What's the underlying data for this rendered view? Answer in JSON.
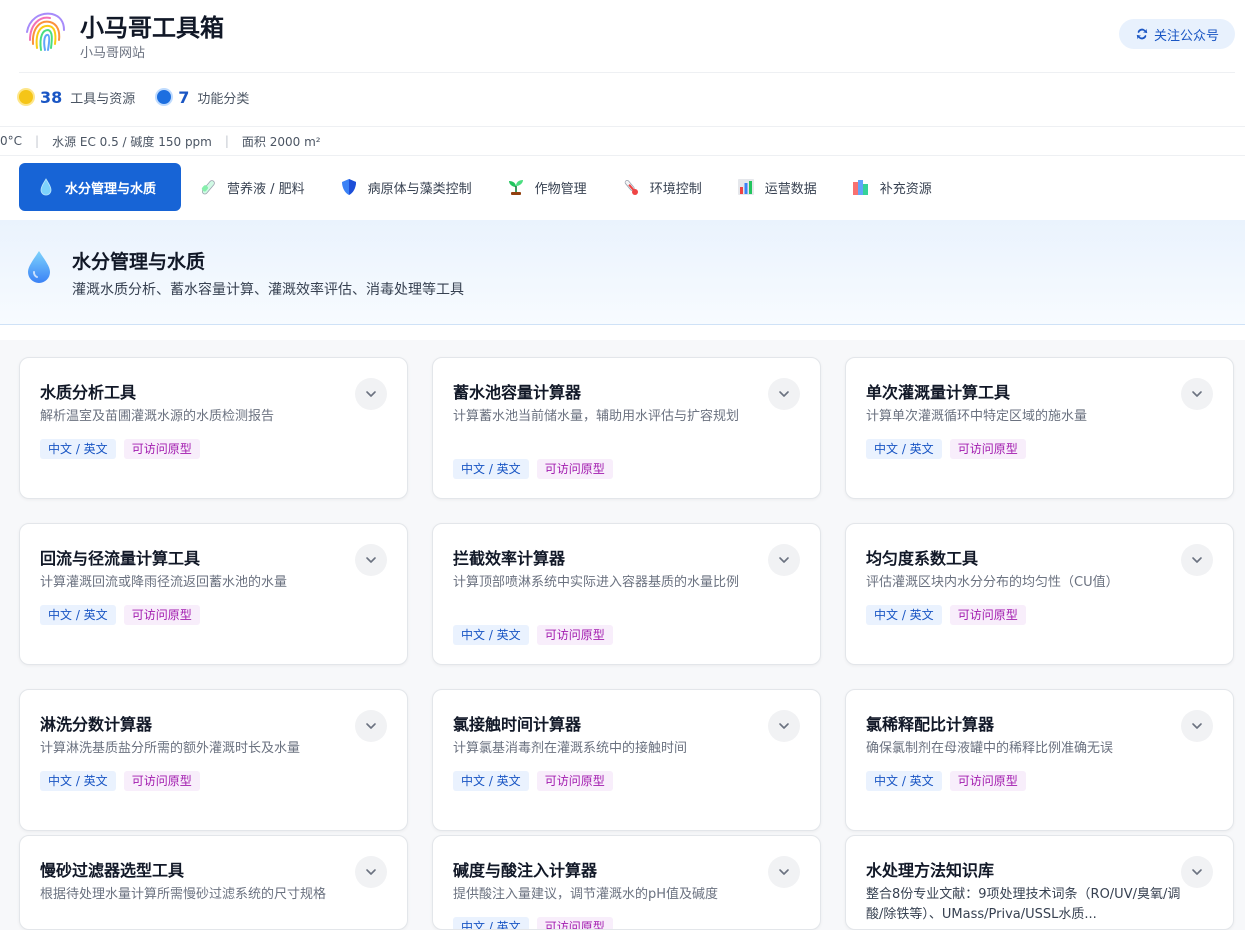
{
  "header": {
    "title": "小马哥工具箱",
    "subtitle": "小马哥网站",
    "follow_label": "关注公众号"
  },
  "stats": [
    {
      "value": "38",
      "label": "工具与资源",
      "color": "#f5c518"
    },
    {
      "value": "7",
      "label": "功能分类",
      "color": "#1d6fe0"
    }
  ],
  "ticker": [
    "0°C",
    "水源 EC 0.5 / 碱度 150 ppm",
    "面积 2000 m²"
  ],
  "tabs": [
    {
      "label": "水分管理与水质",
      "icon": "water-drop-icon",
      "active": true
    },
    {
      "label": "营养液 / 肥料",
      "icon": "test-tube-icon",
      "active": false
    },
    {
      "label": "病原体与藻类控制",
      "icon": "shield-icon",
      "active": false
    },
    {
      "label": "作物管理",
      "icon": "seedling-icon",
      "active": false
    },
    {
      "label": "环境控制",
      "icon": "thermometer-icon",
      "active": false
    },
    {
      "label": "运营数据",
      "icon": "bar-chart-icon",
      "active": false
    },
    {
      "label": "补充资源",
      "icon": "books-icon",
      "active": false
    }
  ],
  "section": {
    "title": "水分管理与水质",
    "description": "灌溉水质分析、蓄水容量计算、灌溉效率评估、消毒处理等工具"
  },
  "tag_labels": {
    "lang": "中文 / 英文",
    "proto": "可访问原型"
  },
  "cards": [
    {
      "title": "水质分析工具",
      "desc": "解析温室及苗圃灌溉水源的水质检测报告"
    },
    {
      "title": "蓄水池容量计算器",
      "desc": "计算蓄水池当前储水量，辅助用水评估与扩容规划"
    },
    {
      "title": "单次灌溉量计算工具",
      "desc": "计算单次灌溉循环中特定区域的施水量"
    },
    {
      "title": "回流与径流量计算工具",
      "desc": "计算灌溉回流或降雨径流返回蓄水池的水量"
    },
    {
      "title": "拦截效率计算器",
      "desc": "计算顶部喷淋系统中实际进入容器基质的水量比例"
    },
    {
      "title": "均匀度系数工具",
      "desc": "评估灌溉区块内水分分布的均匀性（CU值）"
    },
    {
      "title": "淋洗分数计算器",
      "desc": "计算淋洗基质盐分所需的额外灌溉时长及水量"
    },
    {
      "title": "氯接触时间计算器",
      "desc": "计算氯基消毒剂在灌溉系统中的接触时间"
    },
    {
      "title": "氯稀释配比计算器",
      "desc": "确保氯制剂在母液罐中的稀释比例准确无误"
    },
    {
      "title": "慢砂过滤器选型工具",
      "desc": "根据待处理水量计算所需慢砂过滤系统的尺寸规格"
    },
    {
      "title": "碱度与酸注入计算器",
      "desc": "提供酸注入量建议，调节灌溉水的pH值及碱度"
    },
    {
      "title": "水处理方法知识库",
      "desc": "整合8份专业文献：9项处理技术词条（RO/UV/臭氧/调酸/除铁等）、UMass/Priva/USSL水质..."
    }
  ]
}
